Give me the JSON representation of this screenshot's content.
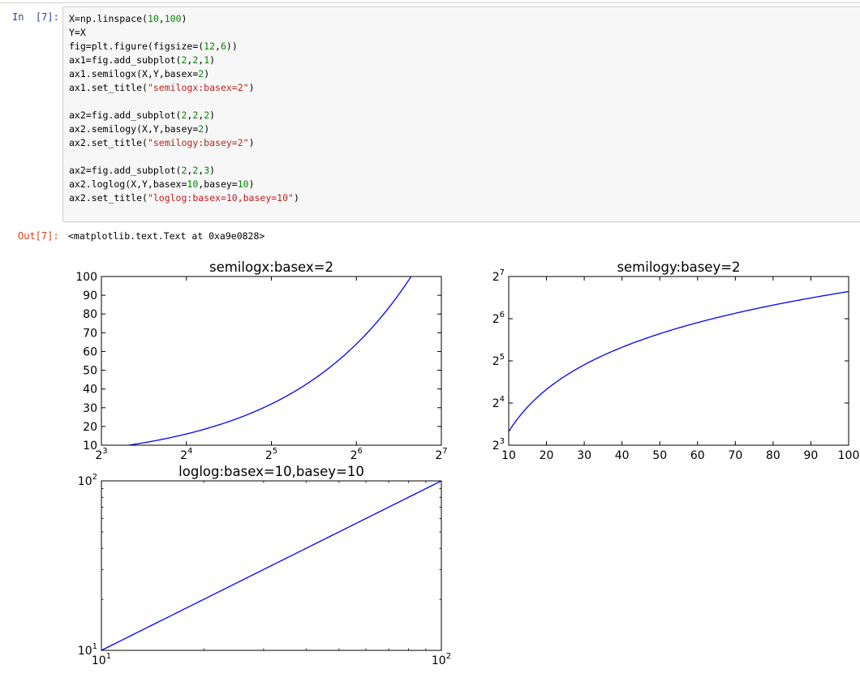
{
  "cell": {
    "in_prompt": "In  [7]:",
    "out_prompt": "Out[7]:",
    "output_text": "<matplotlib.text.Text at 0xa9e0828>",
    "code_lines": [
      [
        {
          "t": "X=np.linspace("
        },
        {
          "t": "10",
          "c": "num"
        },
        {
          "t": ","
        },
        {
          "t": "100",
          "c": "num"
        },
        {
          "t": ")"
        }
      ],
      [
        {
          "t": "Y=X"
        }
      ],
      [
        {
          "t": "fig=plt.figure(figsize=("
        },
        {
          "t": "12",
          "c": "num"
        },
        {
          "t": ","
        },
        {
          "t": "6",
          "c": "num"
        },
        {
          "t": "))"
        }
      ],
      [
        {
          "t": "ax1=fig.add_subplot("
        },
        {
          "t": "2",
          "c": "num"
        },
        {
          "t": ","
        },
        {
          "t": "2",
          "c": "num"
        },
        {
          "t": ","
        },
        {
          "t": "1",
          "c": "num"
        },
        {
          "t": ")"
        }
      ],
      [
        {
          "t": "ax1.semilogx(X,Y,basex="
        },
        {
          "t": "2",
          "c": "num"
        },
        {
          "t": ")"
        }
      ],
      [
        {
          "t": "ax1.set_title("
        },
        {
          "t": "\"semilogx:basex=2\"",
          "c": "str"
        },
        {
          "t": ")"
        }
      ],
      [],
      [
        {
          "t": "ax2=fig.add_subplot("
        },
        {
          "t": "2",
          "c": "num"
        },
        {
          "t": ","
        },
        {
          "t": "2",
          "c": "num"
        },
        {
          "t": ","
        },
        {
          "t": "2",
          "c": "num"
        },
        {
          "t": ")"
        }
      ],
      [
        {
          "t": "ax2.semilogy(X,Y,basey="
        },
        {
          "t": "2",
          "c": "num"
        },
        {
          "t": ")"
        }
      ],
      [
        {
          "t": "ax2.set_title("
        },
        {
          "t": "\"semilogy:basey=2\"",
          "c": "str"
        },
        {
          "t": ")"
        }
      ],
      [],
      [
        {
          "t": "ax2=fig.add_subplot("
        },
        {
          "t": "2",
          "c": "num"
        },
        {
          "t": ","
        },
        {
          "t": "2",
          "c": "num"
        },
        {
          "t": ","
        },
        {
          "t": "3",
          "c": "num"
        },
        {
          "t": ")"
        }
      ],
      [
        {
          "t": "ax2.loglog(X,Y,basex="
        },
        {
          "t": "10",
          "c": "num"
        },
        {
          "t": ",basey="
        },
        {
          "t": "10",
          "c": "num"
        },
        {
          "t": ")"
        }
      ],
      [
        {
          "t": "ax2.set_title("
        },
        {
          "t": "\"loglog:basex=10,basey=10\"",
          "c": "str"
        },
        {
          "t": ")"
        }
      ]
    ]
  },
  "colors": {
    "line": "#0000ff",
    "num": "#008800",
    "str": "#ba2121",
    "in_prompt": "#303f9f",
    "out_prompt": "#d84315"
  },
  "chart_data": [
    {
      "type": "line",
      "title": "semilogx:basex=2",
      "xscale": "log2",
      "xlim": [
        8,
        128
      ],
      "ylim": [
        10,
        100
      ],
      "xticks": [
        {
          "v": 8,
          "base": "2",
          "exp": "3"
        },
        {
          "v": 16,
          "base": "2",
          "exp": "4"
        },
        {
          "v": 32,
          "base": "2",
          "exp": "5"
        },
        {
          "v": 64,
          "base": "2",
          "exp": "6"
        },
        {
          "v": 128,
          "base": "2",
          "exp": "7"
        }
      ],
      "yticks": [
        {
          "v": 10,
          "base": "10"
        },
        {
          "v": 20,
          "base": "20"
        },
        {
          "v": 30,
          "base": "30"
        },
        {
          "v": 40,
          "base": "40"
        },
        {
          "v": 50,
          "base": "50"
        },
        {
          "v": 60,
          "base": "60"
        },
        {
          "v": 70,
          "base": "70"
        },
        {
          "v": 80,
          "base": "80"
        },
        {
          "v": 90,
          "base": "90"
        },
        {
          "v": 100,
          "base": "100"
        }
      ],
      "x": [
        10,
        100
      ],
      "y": [
        10,
        100
      ],
      "relation": "y = x",
      "grid": false
    },
    {
      "type": "line",
      "title": "semilogy:basey=2",
      "yscale": "log2",
      "xlim": [
        10,
        100
      ],
      "ylim": [
        8,
        128
      ],
      "xticks": [
        {
          "v": 10,
          "base": "10"
        },
        {
          "v": 20,
          "base": "20"
        },
        {
          "v": 30,
          "base": "30"
        },
        {
          "v": 40,
          "base": "40"
        },
        {
          "v": 50,
          "base": "50"
        },
        {
          "v": 60,
          "base": "60"
        },
        {
          "v": 70,
          "base": "70"
        },
        {
          "v": 80,
          "base": "80"
        },
        {
          "v": 90,
          "base": "90"
        },
        {
          "v": 100,
          "base": "100"
        }
      ],
      "yticks": [
        {
          "v": 8,
          "base": "2",
          "exp": "3"
        },
        {
          "v": 16,
          "base": "2",
          "exp": "4"
        },
        {
          "v": 32,
          "base": "2",
          "exp": "5"
        },
        {
          "v": 64,
          "base": "2",
          "exp": "6"
        },
        {
          "v": 128,
          "base": "2",
          "exp": "7"
        }
      ],
      "x": [
        10,
        100
      ],
      "y": [
        10,
        100
      ],
      "relation": "y = x",
      "grid": false
    },
    {
      "type": "line",
      "title": "loglog:basex=10,basey=10",
      "xscale": "log10",
      "yscale": "log10",
      "xlim": [
        10,
        100
      ],
      "ylim": [
        10,
        100
      ],
      "xticks": [
        {
          "v": 10,
          "base": "10",
          "exp": "1"
        },
        {
          "v": 100,
          "base": "10",
          "exp": "2"
        }
      ],
      "yticks": [
        {
          "v": 10,
          "base": "10",
          "exp": "1"
        },
        {
          "v": 100,
          "base": "10",
          "exp": "2"
        }
      ],
      "x": [
        10,
        100
      ],
      "y": [
        10,
        100
      ],
      "relation": "y = x",
      "grid": false
    }
  ]
}
